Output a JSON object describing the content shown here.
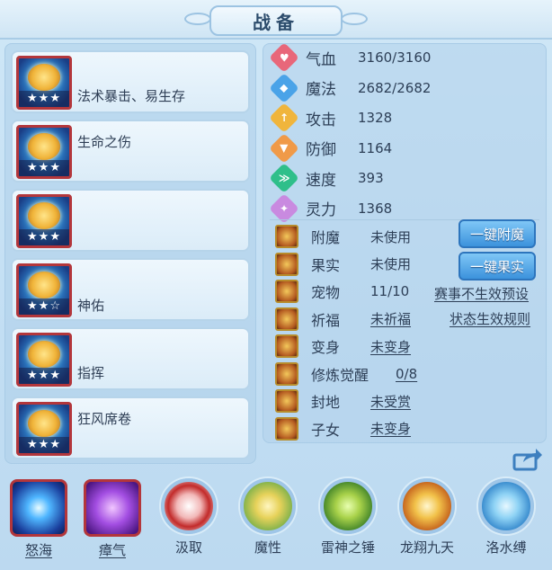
{
  "title": "战备",
  "equipment": [
    {
      "label": "法术暴击、易生存",
      "stars": "★★★"
    },
    {
      "label": "生命之伤",
      "stars": "★★★"
    },
    {
      "label": "",
      "stars": "★★★"
    },
    {
      "label": "神佑",
      "stars": "★★☆"
    },
    {
      "label": "指挥",
      "stars": "★★★"
    },
    {
      "label": "狂风席卷",
      "stars": "★★★"
    }
  ],
  "stats": [
    {
      "name": "气血",
      "value": "3160/3160",
      "icon": "heart-icon",
      "color": "#e8677a",
      "glyph": "♥"
    },
    {
      "name": "魔法",
      "value": "2682/2682",
      "icon": "mana-icon",
      "color": "#4aa3e8",
      "glyph": "◆"
    },
    {
      "name": "攻击",
      "value": "1328",
      "icon": "sword-icon",
      "color": "#f0b53c",
      "glyph": "↑"
    },
    {
      "name": "防御",
      "value": "1164",
      "icon": "shield-icon",
      "color": "#f09a48",
      "glyph": "▼"
    },
    {
      "name": "速度",
      "value": "393",
      "icon": "speed-icon",
      "color": "#2fbf8a",
      "glyph": "≫"
    },
    {
      "name": "灵力",
      "value": "1368",
      "icon": "spirit-icon",
      "color": "#c98ae0",
      "glyph": "✦"
    }
  ],
  "bonuses": [
    {
      "name": "附魔",
      "value": "未使用",
      "underline": false,
      "icon": "enchant-icon"
    },
    {
      "name": "果实",
      "value": "未使用",
      "underline": false,
      "icon": "fruit-icon"
    },
    {
      "name": "宠物",
      "value": "11/10",
      "underline": false,
      "icon": "pet-icon"
    },
    {
      "name": "祈福",
      "value": "未祈福",
      "underline": true,
      "icon": "blessing-icon"
    },
    {
      "name": "变身",
      "value": "未变身",
      "underline": true,
      "icon": "transform-icon"
    },
    {
      "name": "修炼觉醒",
      "value": "0/8",
      "underline": true,
      "icon": "cultivation-icon"
    },
    {
      "name": "封地",
      "value": "未受赏",
      "underline": true,
      "icon": "fief-icon"
    },
    {
      "name": "子女",
      "value": "未变身",
      "underline": true,
      "icon": "children-icon"
    }
  ],
  "buttons": {
    "enchant": "一键附魔",
    "fruit": "一键果实"
  },
  "links": {
    "event_preset": "赛事不生效预设",
    "status_rules": "状态生效规则"
  },
  "skills": [
    {
      "label": "怒海",
      "style": "square",
      "underline": true
    },
    {
      "label": "瘴气",
      "style": "square",
      "underline": true
    },
    {
      "label": "汲取",
      "style": "round",
      "underline": false
    },
    {
      "label": "魔性",
      "style": "round",
      "underline": false
    },
    {
      "label": "雷神之锤",
      "style": "round",
      "underline": false
    },
    {
      "label": "龙翔九天",
      "style": "round",
      "underline": false
    },
    {
      "label": "洛水缚",
      "style": "round",
      "underline": false
    }
  ]
}
